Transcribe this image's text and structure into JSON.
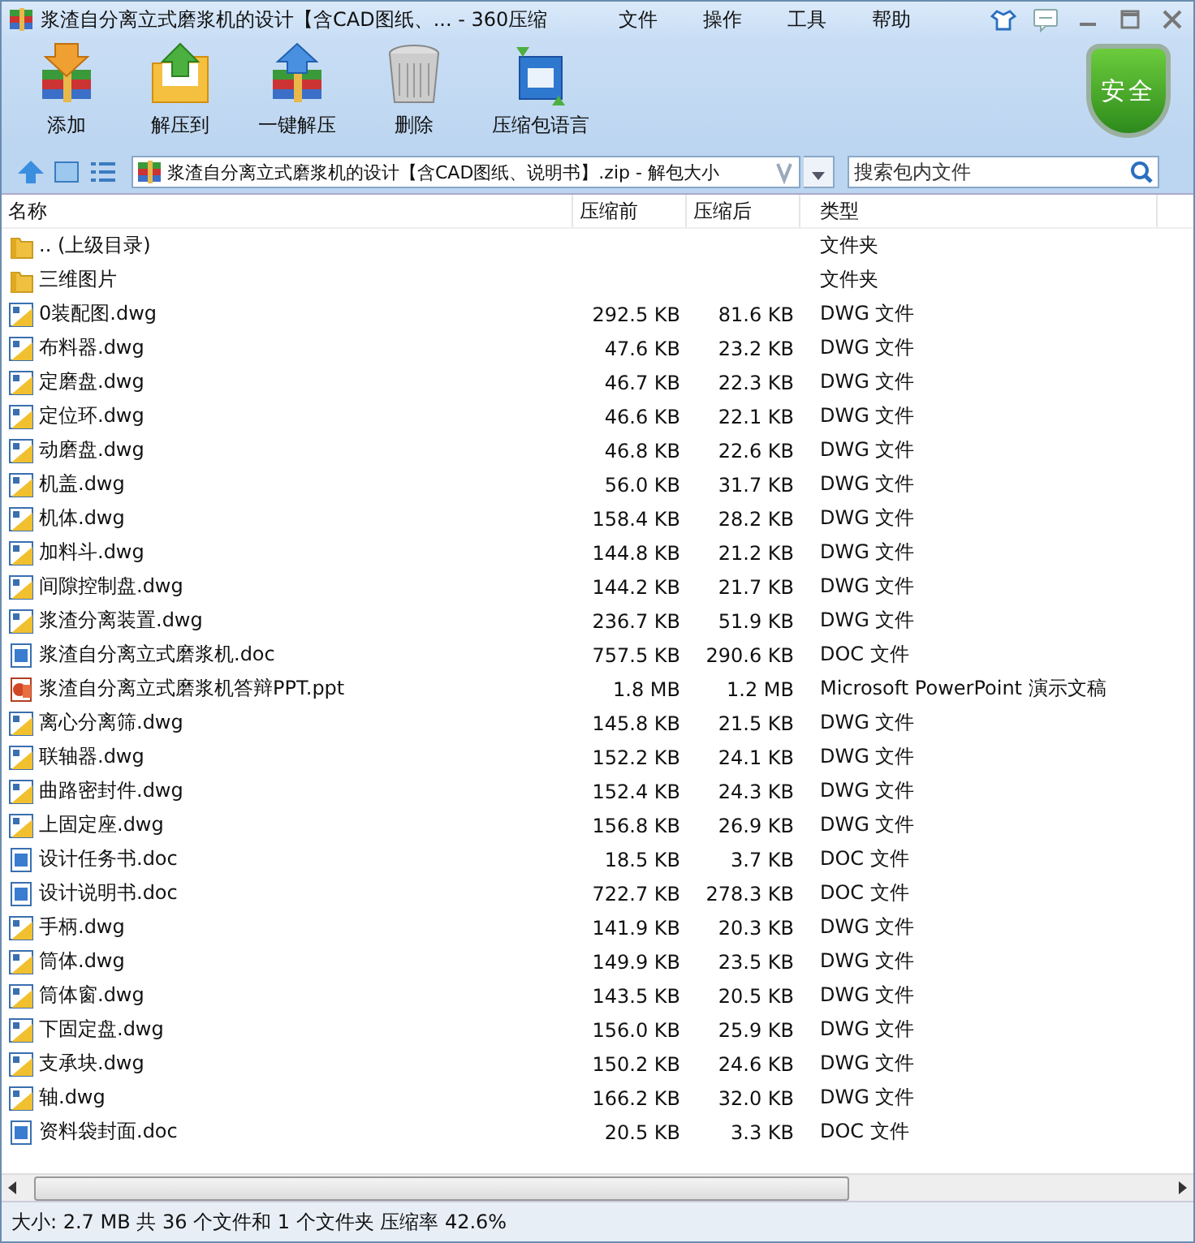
{
  "window": {
    "title": "浆渣自分离立式磨浆机的设计【含CAD图纸、... - 360压缩"
  },
  "menu": [
    "文件",
    "操作",
    "工具",
    "帮助"
  ],
  "toolbar": [
    "添加",
    "解压到",
    "一键解压",
    "删除",
    "压缩包语言"
  ],
  "security_badge": "安全",
  "address": {
    "path": "浆渣自分离立式磨浆机的设计【含CAD图纸、说明书】.zip - 解包大小",
    "search_placeholder": "搜索包内文件"
  },
  "table": {
    "columns": [
      "名称",
      "压缩前",
      "压缩后",
      "类型"
    ],
    "rows": [
      {
        "kind": "folder",
        "name": ".. (上级目录)",
        "size": "",
        "packed": "",
        "type": "文件夹"
      },
      {
        "kind": "folder",
        "name": "三维图片",
        "size": "",
        "packed": "",
        "type": "文件夹"
      },
      {
        "kind": "dwg",
        "name": "0装配图.dwg",
        "size": "292.5 KB",
        "packed": "81.6 KB",
        "type": "DWG 文件"
      },
      {
        "kind": "dwg",
        "name": "布料器.dwg",
        "size": "47.6 KB",
        "packed": "23.2 KB",
        "type": "DWG 文件"
      },
      {
        "kind": "dwg",
        "name": "定磨盘.dwg",
        "size": "46.7 KB",
        "packed": "22.3 KB",
        "type": "DWG 文件"
      },
      {
        "kind": "dwg",
        "name": "定位环.dwg",
        "size": "46.6 KB",
        "packed": "22.1 KB",
        "type": "DWG 文件"
      },
      {
        "kind": "dwg",
        "name": "动磨盘.dwg",
        "size": "46.8 KB",
        "packed": "22.6 KB",
        "type": "DWG 文件"
      },
      {
        "kind": "dwg",
        "name": "机盖.dwg",
        "size": "56.0 KB",
        "packed": "31.7 KB",
        "type": "DWG 文件"
      },
      {
        "kind": "dwg",
        "name": "机体.dwg",
        "size": "158.4 KB",
        "packed": "28.2 KB",
        "type": "DWG 文件"
      },
      {
        "kind": "dwg",
        "name": "加料斗.dwg",
        "size": "144.8 KB",
        "packed": "21.2 KB",
        "type": "DWG 文件"
      },
      {
        "kind": "dwg",
        "name": "间隙控制盘.dwg",
        "size": "144.2 KB",
        "packed": "21.7 KB",
        "type": "DWG 文件"
      },
      {
        "kind": "dwg",
        "name": "浆渣分离装置.dwg",
        "size": "236.7 KB",
        "packed": "51.9 KB",
        "type": "DWG 文件"
      },
      {
        "kind": "doc",
        "name": "浆渣自分离立式磨浆机.doc",
        "size": "757.5 KB",
        "packed": "290.6 KB",
        "type": "DOC 文件"
      },
      {
        "kind": "ppt",
        "name": "浆渣自分离立式磨浆机答辩PPT.ppt",
        "size": "1.8 MB",
        "packed": "1.2 MB",
        "type": "Microsoft PowerPoint 演示文稿"
      },
      {
        "kind": "dwg",
        "name": "离心分离筛.dwg",
        "size": "145.8 KB",
        "packed": "21.5 KB",
        "type": "DWG 文件"
      },
      {
        "kind": "dwg",
        "name": "联轴器.dwg",
        "size": "152.2 KB",
        "packed": "24.1 KB",
        "type": "DWG 文件"
      },
      {
        "kind": "dwg",
        "name": "曲路密封件.dwg",
        "size": "152.4 KB",
        "packed": "24.3 KB",
        "type": "DWG 文件"
      },
      {
        "kind": "dwg",
        "name": "上固定座.dwg",
        "size": "156.8 KB",
        "packed": "26.9 KB",
        "type": "DWG 文件"
      },
      {
        "kind": "doc",
        "name": "设计任务书.doc",
        "size": "18.5 KB",
        "packed": "3.7 KB",
        "type": "DOC 文件"
      },
      {
        "kind": "doc",
        "name": "设计说明书.doc",
        "size": "722.7 KB",
        "packed": "278.3 KB",
        "type": "DOC 文件"
      },
      {
        "kind": "dwg",
        "name": "手柄.dwg",
        "size": "141.9 KB",
        "packed": "20.3 KB",
        "type": "DWG 文件"
      },
      {
        "kind": "dwg",
        "name": "筒体.dwg",
        "size": "149.9 KB",
        "packed": "23.5 KB",
        "type": "DWG 文件"
      },
      {
        "kind": "dwg",
        "name": "筒体窗.dwg",
        "size": "143.5 KB",
        "packed": "20.5 KB",
        "type": "DWG 文件"
      },
      {
        "kind": "dwg",
        "name": "下固定盘.dwg",
        "size": "156.0 KB",
        "packed": "25.9 KB",
        "type": "DWG 文件"
      },
      {
        "kind": "dwg",
        "name": "支承块.dwg",
        "size": "150.2 KB",
        "packed": "24.6 KB",
        "type": "DWG 文件"
      },
      {
        "kind": "dwg",
        "name": "轴.dwg",
        "size": "166.2 KB",
        "packed": "32.0 KB",
        "type": "DWG 文件"
      },
      {
        "kind": "doc",
        "name": "资料袋封面.doc",
        "size": "20.5 KB",
        "packed": "3.3 KB",
        "type": "DOC 文件"
      }
    ]
  },
  "status_bar": "大小: 2.7 MB 共 36 个文件和 1 个文件夹 压缩率 42.6%"
}
